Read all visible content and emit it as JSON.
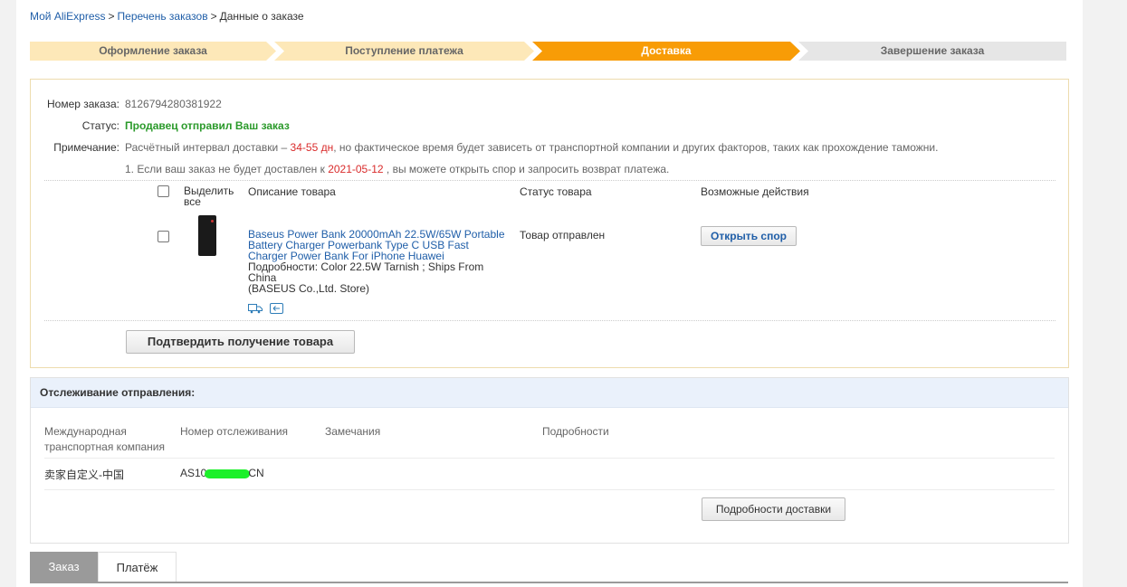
{
  "breadcrumb": {
    "items": [
      "Мой AliExpress",
      "Перечень заказов"
    ],
    "current": "Данные о заказе",
    "separator": ">"
  },
  "steps": [
    {
      "label": "Оформление заказа",
      "state": "done"
    },
    {
      "label": "Поступление платежа",
      "state": "done"
    },
    {
      "label": "Доставка",
      "state": "active"
    },
    {
      "label": "Завершение заказа",
      "state": "pending"
    }
  ],
  "order": {
    "number_label": "Номер заказа:",
    "number": "8126794280381922",
    "status_label": "Статус:",
    "status": "Продавец отправил Ваш заказ",
    "note_label": "Примечание:",
    "note_prefix": "Расчётный интервал доставки –",
    "note_interval": "34-55 дн",
    "note_suffix": ", но фактическое время будет зависеть от транспортной компании и других факторов, таких как прохождение таможни.",
    "note2_prefix": "1. Если ваш заказ не будет доставлен к",
    "note2_date": "2021-05-12",
    "note2_suffix": ", вы можете открыть спор и запросить возврат платежа."
  },
  "items_table": {
    "col_select": "Выделить все",
    "col_desc": "Описание товара",
    "col_status": "Статус товара",
    "col_actions": "Возможные действия",
    "rows": [
      {
        "title": "Baseus Power Bank 20000mAh 22.5W/65W Portable Battery Charger Powerbank Type C USB Fast Charger Power Bank For iPhone Huawei",
        "details": "Подробности: Color 22.5W Tarnish   ; Ships From China",
        "store": "(BASEUS Co.,Ltd. Store)",
        "status": "Товар отправлен",
        "action": "Открыть спор"
      }
    ],
    "confirm_button": "Подтвердить получение товара"
  },
  "tracking": {
    "header": "Отслеживание отправления:",
    "col_carrier": "Международная транспортная компания",
    "col_number": "Номер отслеживания",
    "col_remarks": "Замечания",
    "col_details": "Подробности",
    "carrier": "卖家自定义-中国",
    "number_prefix": "AS10",
    "number_suffix": "CN",
    "details_button": "Подробности доставки"
  },
  "tabs": [
    {
      "label": "Заказ",
      "active": true
    },
    {
      "label": "Платёж",
      "active": false
    }
  ],
  "colors": {
    "accent": "#f89c06",
    "link": "#1f5ea8",
    "status_green": "#2b9a2b",
    "highlight_red": "#d92b2b"
  }
}
